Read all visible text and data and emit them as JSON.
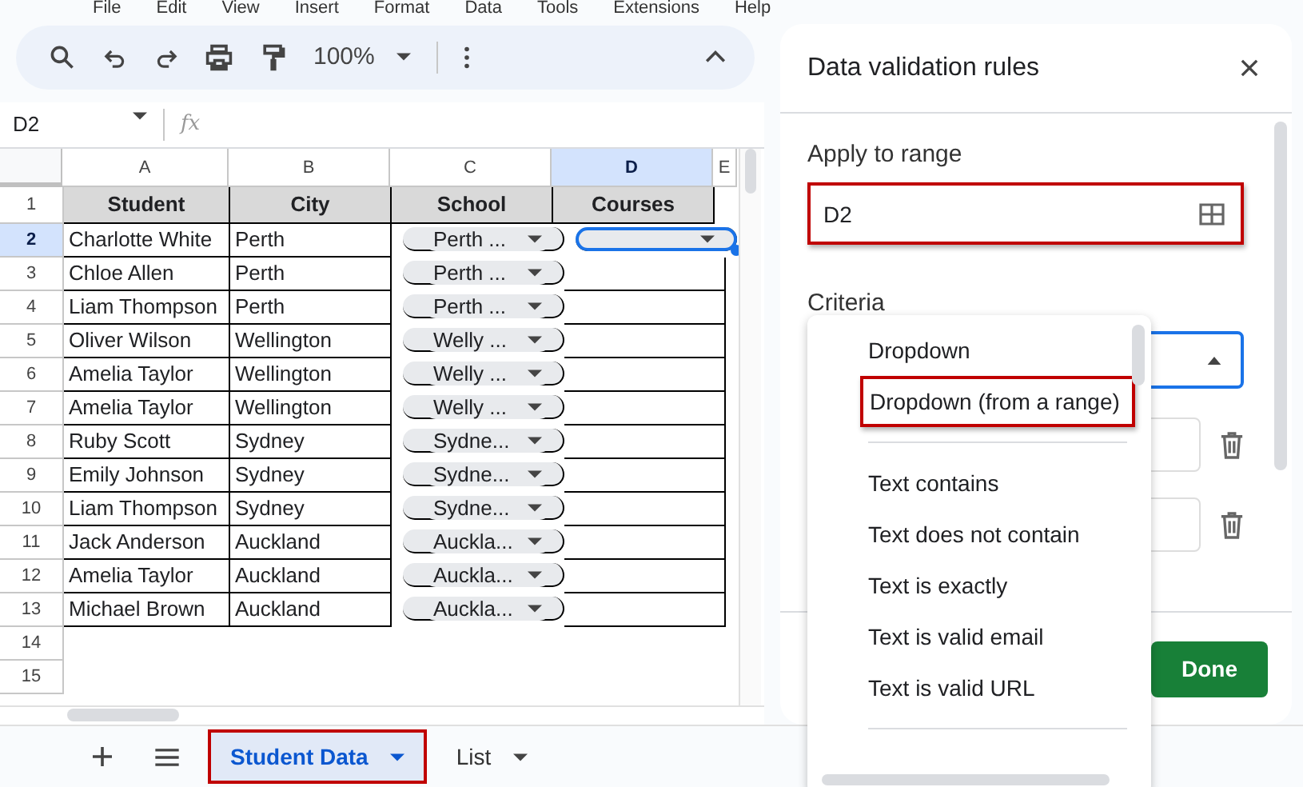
{
  "menu_bar": [
    "File",
    "Edit",
    "View",
    "Insert",
    "Format",
    "Data",
    "Tools",
    "Extensions",
    "Help"
  ],
  "toolbar": {
    "zoom": "100%"
  },
  "formula_bar": {
    "cell_ref": "D2",
    "fx": "fx"
  },
  "sheet": {
    "columns": [
      {
        "label": "A",
        "selected": false
      },
      {
        "label": "B",
        "selected": false
      },
      {
        "label": "C",
        "selected": false
      },
      {
        "label": "D",
        "selected": true
      },
      {
        "label": "E",
        "selected": false
      }
    ],
    "rows": [
      {
        "number": "1",
        "selected": false,
        "cells": [
          {
            "kind": "header",
            "text": "Student"
          },
          {
            "kind": "header",
            "text": "City"
          },
          {
            "kind": "header",
            "text": "School"
          },
          {
            "kind": "header",
            "text": "Courses"
          }
        ]
      },
      {
        "number": "2",
        "selected": true,
        "cells": [
          {
            "kind": "text",
            "text": "Charlotte White"
          },
          {
            "kind": "text",
            "text": "Perth"
          },
          {
            "kind": "chip",
            "text": "Perth ..."
          },
          {
            "kind": "chip"
          }
        ]
      },
      {
        "number": "3",
        "selected": false,
        "cells": [
          {
            "kind": "text",
            "text": "Chloe Allen"
          },
          {
            "kind": "text",
            "text": "Perth"
          },
          {
            "kind": "chip",
            "text": "Perth ..."
          },
          {
            "kind": "text"
          }
        ]
      },
      {
        "number": "4",
        "selected": false,
        "cells": [
          {
            "kind": "text",
            "text": "Liam Thompson"
          },
          {
            "kind": "text",
            "text": "Perth"
          },
          {
            "kind": "chip",
            "text": "Perth ..."
          },
          {
            "kind": "text"
          }
        ]
      },
      {
        "number": "5",
        "selected": false,
        "cells": [
          {
            "kind": "text",
            "text": "Oliver Wilson"
          },
          {
            "kind": "text",
            "text": "Wellington"
          },
          {
            "kind": "chip",
            "text": "Welly ..."
          },
          {
            "kind": "text"
          }
        ]
      },
      {
        "number": "6",
        "selected": false,
        "cells": [
          {
            "kind": "text",
            "text": "Amelia Taylor"
          },
          {
            "kind": "text",
            "text": "Wellington"
          },
          {
            "kind": "chip",
            "text": "Welly ..."
          },
          {
            "kind": "text"
          }
        ]
      },
      {
        "number": "7",
        "selected": false,
        "cells": [
          {
            "kind": "text",
            "text": "Amelia Taylor"
          },
          {
            "kind": "text",
            "text": "Wellington"
          },
          {
            "kind": "chip",
            "text": "Welly ..."
          },
          {
            "kind": "text"
          }
        ]
      },
      {
        "number": "8",
        "selected": false,
        "cells": [
          {
            "kind": "text",
            "text": "Ruby Scott"
          },
          {
            "kind": "text",
            "text": "Sydney"
          },
          {
            "kind": "chip",
            "text": "Sydne..."
          },
          {
            "kind": "text"
          }
        ]
      },
      {
        "number": "9",
        "selected": false,
        "cells": [
          {
            "kind": "text",
            "text": "Emily Johnson"
          },
          {
            "kind": "text",
            "text": "Sydney"
          },
          {
            "kind": "chip",
            "text": "Sydne..."
          },
          {
            "kind": "text"
          }
        ]
      },
      {
        "number": "10",
        "selected": false,
        "cells": [
          {
            "kind": "text",
            "text": "Liam Thompson"
          },
          {
            "kind": "text",
            "text": "Sydney"
          },
          {
            "kind": "chip",
            "text": "Sydne..."
          },
          {
            "kind": "text"
          }
        ]
      },
      {
        "number": "11",
        "selected": false,
        "cells": [
          {
            "kind": "text",
            "text": "Jack Anderson"
          },
          {
            "kind": "text",
            "text": "Auckland"
          },
          {
            "kind": "chip",
            "text": "Auckla..."
          },
          {
            "kind": "text"
          }
        ]
      },
      {
        "number": "12",
        "selected": false,
        "cells": [
          {
            "kind": "text",
            "text": "Amelia Taylor"
          },
          {
            "kind": "text",
            "text": "Auckland"
          },
          {
            "kind": "chip",
            "text": "Auckla..."
          },
          {
            "kind": "text"
          }
        ]
      },
      {
        "number": "13",
        "selected": false,
        "cells": [
          {
            "kind": "text",
            "text": "Michael Brown"
          },
          {
            "kind": "text",
            "text": "Auckland"
          },
          {
            "kind": "chip",
            "text": "Auckla..."
          },
          {
            "kind": "text"
          }
        ]
      },
      {
        "number": "14",
        "selected": false,
        "cells": []
      },
      {
        "number": "15",
        "selected": false,
        "cells": []
      }
    ]
  },
  "sheet_tabs": [
    {
      "label": "Student Data",
      "selected": true,
      "highlighted": true
    },
    {
      "label": "List",
      "selected": false,
      "highlighted": false
    }
  ],
  "panel": {
    "title": "Data validation rules",
    "apply_label": "Apply to range",
    "range_field": {
      "value": "D2",
      "highlighted": true
    },
    "criteria_label": "Criteria",
    "criteria_menu": [
      {
        "label": "Dropdown",
        "highlighted": false
      },
      {
        "label": "Dropdown (from a range)",
        "highlighted": true
      },
      {
        "kind": "divider"
      },
      {
        "label": "Text contains",
        "highlighted": false
      },
      {
        "label": "Text does not contain",
        "highlighted": false
      },
      {
        "label": "Text is exactly",
        "highlighted": false
      },
      {
        "label": "Text is valid email",
        "highlighted": false
      },
      {
        "label": "Text is valid URL",
        "highlighted": false
      },
      {
        "kind": "divider"
      }
    ],
    "done": "Done"
  }
}
